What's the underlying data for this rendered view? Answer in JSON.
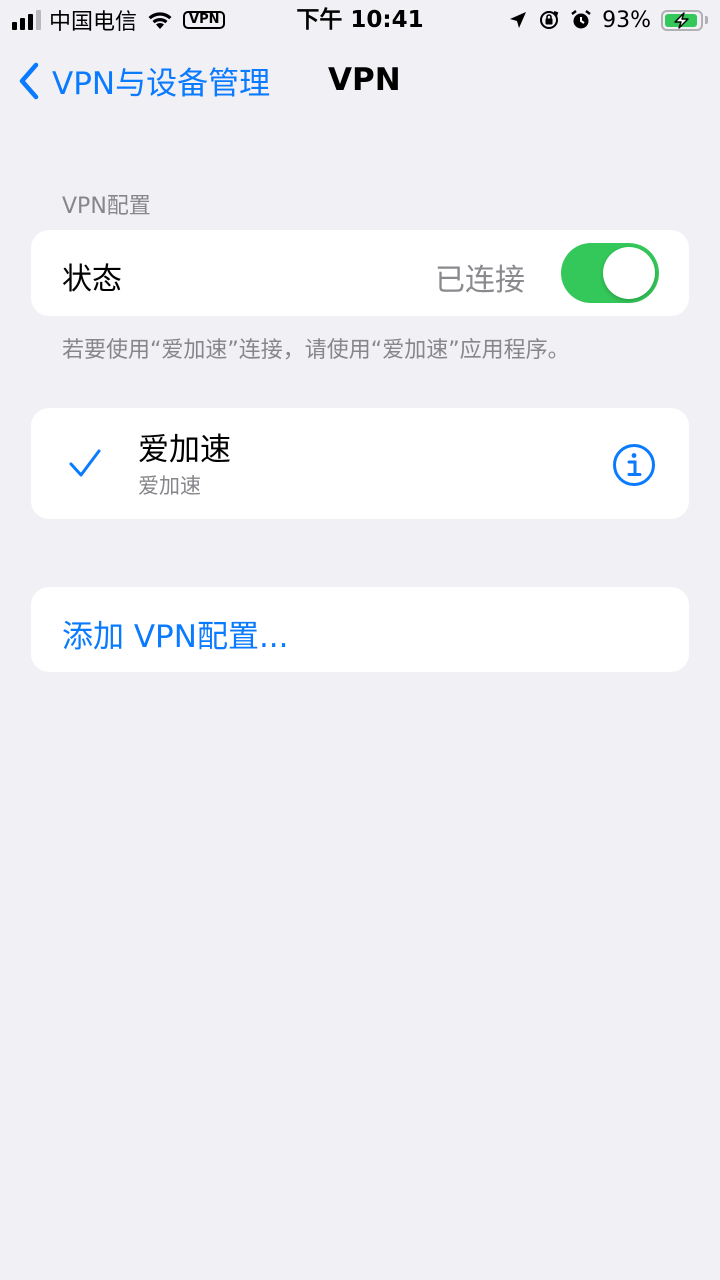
{
  "status_bar": {
    "carrier": "中国电信",
    "vpn_badge": "VPN",
    "time": "下午 10:41",
    "battery_percent": "93%",
    "battery_level": 0.93,
    "signal_bars_active": 3,
    "icons": [
      "signal-icon",
      "wifi-icon",
      "vpn-badge",
      "location-icon",
      "orientation-lock-icon",
      "alarm-icon",
      "battery-charging-icon"
    ]
  },
  "nav": {
    "back_label": "VPN与设备管理",
    "title": "VPN"
  },
  "vpn_config": {
    "section_header": "VPN配置",
    "status_label": "状态",
    "status_value": "已连接",
    "toggle_on": true,
    "footer_note": "若要使用“爱加速”连接，请使用“爱加速”应用程序。"
  },
  "vpn_list": [
    {
      "name": "爱加速",
      "subtitle": "爱加速",
      "selected": true
    }
  ],
  "add_config_label": "添加 VPN配置...",
  "colors": {
    "accent": "#0a7aff",
    "toggle_on": "#34c759",
    "background": "#f0f0f5",
    "secondary_text": "#86868b"
  }
}
